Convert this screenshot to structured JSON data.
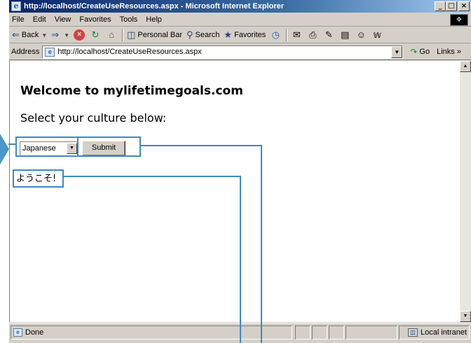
{
  "window": {
    "title": "http://localhost/CreateUseResources.aspx - Microsoft Internet Explorer",
    "title_icon": "ie-page-icon",
    "controls": [
      "_",
      "̅̅̅",
      "×"
    ]
  },
  "menu": {
    "items": [
      "File",
      "Edit",
      "View",
      "Favorites",
      "Tools",
      "Help"
    ]
  },
  "toolbar": {
    "back_label": "Back",
    "personal_bar_label": "Personal Bar",
    "search_label": "Search",
    "favorites_label": "Favorites"
  },
  "address": {
    "label": "Address",
    "url": "http://localhost/CreateUseResources.aspx",
    "go_label": "Go",
    "links_label": "Links »"
  },
  "page": {
    "heading": "Welcome to mylifetimegoals.com",
    "prompt": "Select your culture below:",
    "culture_selected": "Japanese",
    "submit_label": "Submit",
    "welcome_message": "ようこそ!"
  },
  "status": {
    "text": "Done",
    "zone": "Local intranet"
  },
  "colors": {
    "callout": "#3d89c4",
    "titlebar_start": "#0a246a",
    "titlebar_end": "#a6caf0",
    "chrome": "#d4d0c8"
  }
}
